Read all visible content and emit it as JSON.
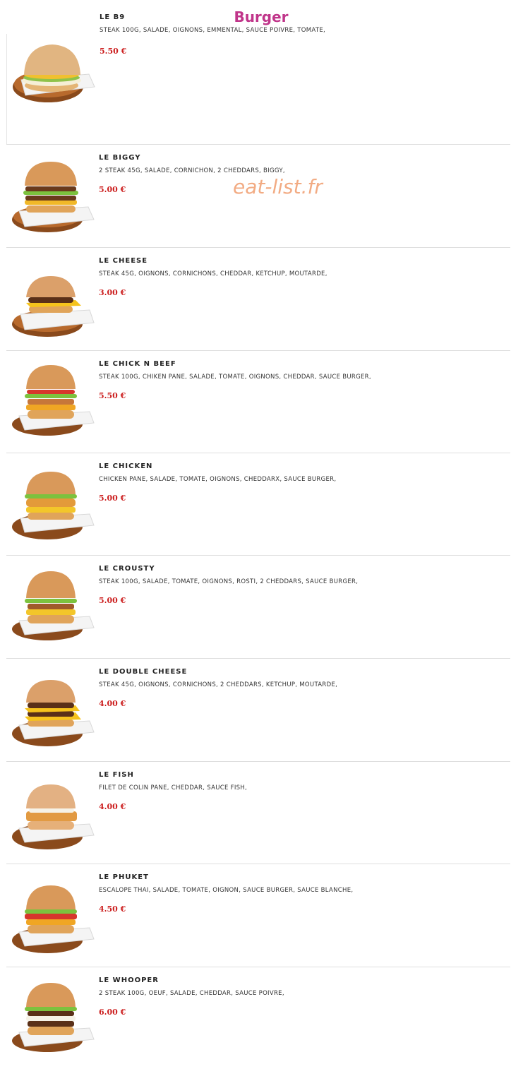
{
  "page": {
    "title": "Burger",
    "watermark": "eat-list.fr"
  },
  "items": [
    {
      "name": "LE B9",
      "description": "STEAK 100G, SALADE, OIGNONS, EMMENTAL, SAUCE POIVRE, TOMATE,",
      "price": "5.50 €",
      "image_icon": "burger-photo"
    },
    {
      "name": "LE BIGGY",
      "description": "2 STEAK 45G, SALADE, CORNICHON, 2 CHEDDARS, BIGGY,",
      "price": "5.00 €",
      "image_icon": "burger-photo"
    },
    {
      "name": "LE CHEESE",
      "description": "STEAK 45G, OIGNONS, CORNICHONS, CHEDDAR, KETCHUP, MOUTARDE,",
      "price": "3.00 €",
      "image_icon": "burger-photo"
    },
    {
      "name": "LE CHICK N BEEF",
      "description": "STEAK 100G, CHIKEN PANE, SALADE, TOMATE, OIGNONS, CHEDDAR, SAUCE BURGER,",
      "price": "5.50 €",
      "image_icon": "burger-photo"
    },
    {
      "name": "LE CHICKEN",
      "description": "CHICKEN PANE, SALADE, TOMATE, OIGNONS, CHEDDARX, SAUCE BURGER,",
      "price": "5.00 €",
      "image_icon": "burger-photo"
    },
    {
      "name": "LE CROUSTY",
      "description": "STEAK 100G, SALADE, TOMATE, OIGNONS, ROSTI, 2 CHEDDARS, SAUCE BURGER,",
      "price": "5.00 €",
      "image_icon": "burger-photo"
    },
    {
      "name": "LE DOUBLE CHEESE",
      "description": "STEAK 45G, OIGNONS, CORNICHONS, 2 CHEDDARS, KETCHUP, MOUTARDE,",
      "price": "4.00 €",
      "image_icon": "burger-photo"
    },
    {
      "name": "LE FISH",
      "description": "FILET DE COLIN PANE, CHEDDAR, SAUCE FISH,",
      "price": "4.00 €",
      "image_icon": "burger-photo"
    },
    {
      "name": "LE PHUKET",
      "description": "ESCALOPE THAI, SALADE, TOMATE, OIGNON, SAUCE BURGER, SAUCE BLANCHE,",
      "price": "4.50 €",
      "image_icon": "burger-photo"
    },
    {
      "name": "LE WHOOPER",
      "description": "2 STEAK 100G, OEUF, SALADE, CHEDDAR, SAUCE POIVRE,",
      "price": "6.00 €",
      "image_icon": "burger-photo"
    }
  ],
  "colors": {
    "title": "#c0358a",
    "price": "#cc1f1f",
    "watermark": "#f1a276"
  }
}
